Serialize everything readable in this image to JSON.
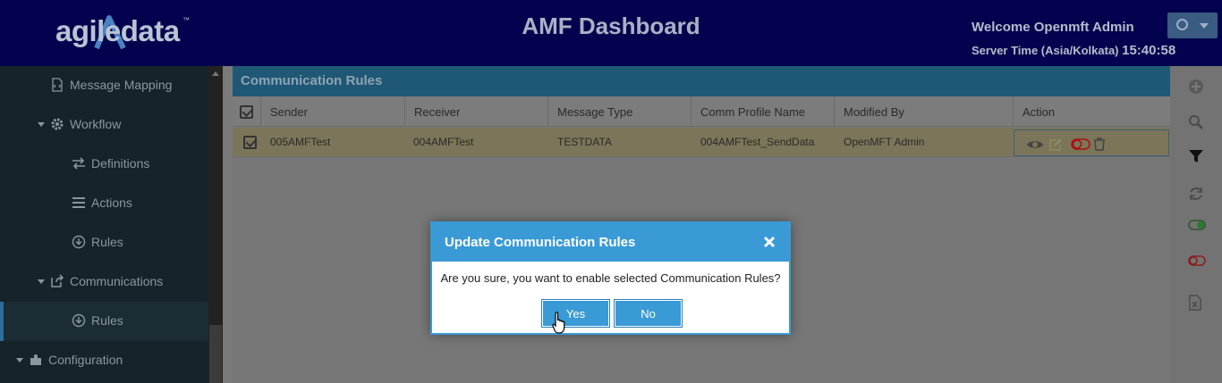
{
  "header": {
    "logo_text": "agiledata",
    "logo_tm": "™",
    "title": "AMF Dashboard",
    "welcome": "Welcome Openmft Admin",
    "server_time_label": "Server Time (Asia/Kolkata)",
    "server_time_value": "15:40:58"
  },
  "sidebar": {
    "items": [
      {
        "label": "Message Mapping",
        "icon": "code-file-icon"
      },
      {
        "label": "Workflow",
        "icon": "gear-icon"
      },
      {
        "label": "Definitions",
        "icon": "exchange-icon"
      },
      {
        "label": "Actions",
        "icon": "list-icon"
      },
      {
        "label": "Rules",
        "icon": "circle-arrow-icon"
      },
      {
        "label": "Communications",
        "icon": "share-icon"
      },
      {
        "label": "Rules",
        "icon": "circle-arrow-icon"
      },
      {
        "label": "Configuration",
        "icon": "puzzle-icon"
      }
    ]
  },
  "panel": {
    "title": "Communication Rules",
    "columns": [
      "Sender",
      "Receiver",
      "Message Type",
      "Comm Profile Name",
      "Modified By",
      "Action"
    ],
    "rows": [
      {
        "sender": "005AMFTest",
        "receiver": "004AMFTest",
        "message_type": "TESTDATA",
        "comm_profile": "004AMFTest_SendData",
        "modified_by": "OpenMFT Admin"
      }
    ]
  },
  "modal": {
    "title": "Update Communication Rules",
    "message": "Are you sure, you want to enable selected Communication Rules?",
    "yes_label": "Yes",
    "no_label": "No"
  },
  "colors": {
    "header_bg": "#02024e",
    "sidebar_bg": "#16232a",
    "accent": "#3a9ad6"
  }
}
